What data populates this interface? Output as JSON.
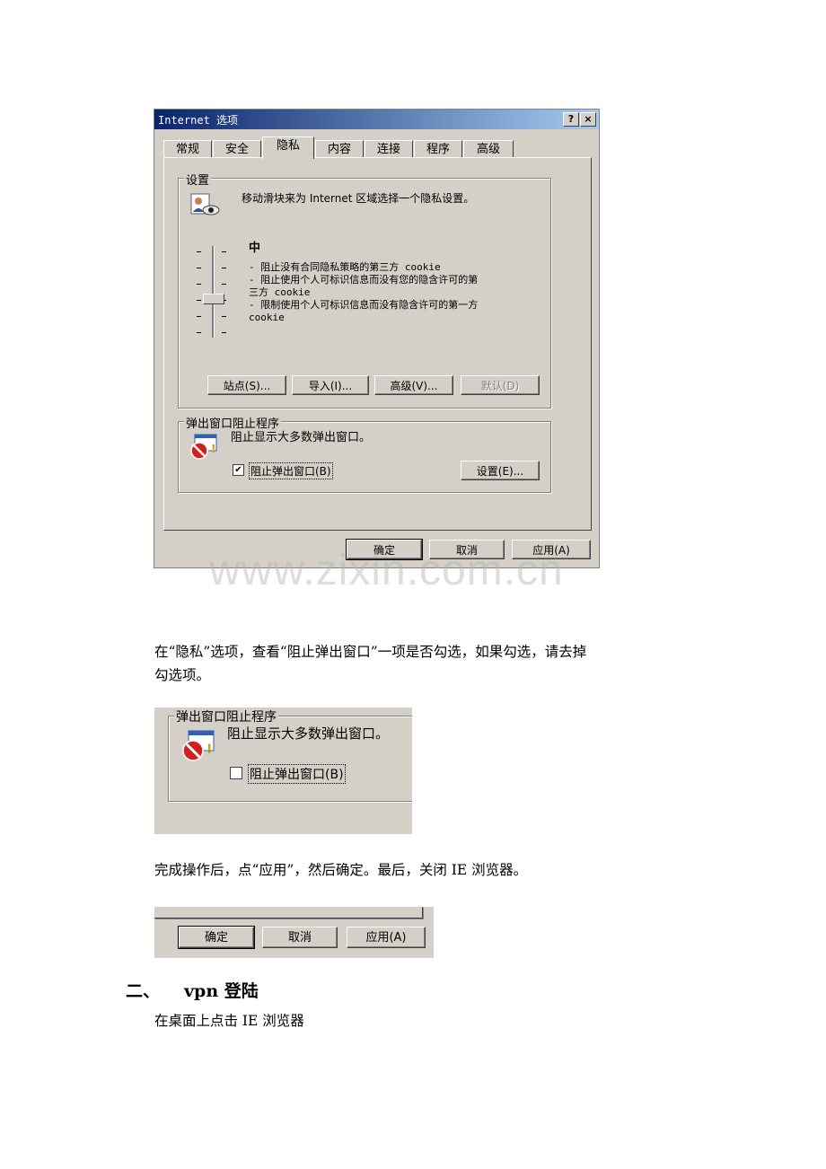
{
  "dialog": {
    "title": "Internet 选项",
    "help_btn": "?",
    "close_btn": "×",
    "tabs": [
      "常规",
      "安全",
      "隐私",
      "内容",
      "连接",
      "程序",
      "高级"
    ],
    "settings_group": {
      "label": "设置",
      "instruction": "移动滑块来为 Internet 区域选择一个隐私设置。",
      "level": "中",
      "level_desc": [
        "- 阻止没有合同隐私策略的第三方 cookie",
        "- 阻止使用个人可标识信息而没有您的隐含许可的第",
        "三方 cookie",
        "- 限制使用个人可标识信息而没有隐含许可的第一方",
        "cookie"
      ],
      "buttons": {
        "sites": "站点(S)...",
        "import": "导入(I)...",
        "advanced": "高级(V)...",
        "default": "默认(D)"
      }
    },
    "popup_group": {
      "label": "弹出窗口阻止程序",
      "desc": "阻止显示大多数弹出窗口。",
      "checkbox_label": "阻止弹出窗口(B)",
      "checked": true,
      "settings_btn": "设置(E)..."
    },
    "footer": {
      "ok": "确定",
      "cancel": "取消",
      "apply": "应用(A)"
    }
  },
  "watermark": "www.zixin.com.cn",
  "para1_line1": "在“隐私”选项，查看“阻止弹出窗口”一项是否勾选，如果勾选，请去掉",
  "para1_line2": "勾选项。",
  "crop2": {
    "label": "弹出窗口阻止程序",
    "desc": "阻止显示大多数弹出窗口。",
    "checkbox_label": "阻止弹出窗口(B)",
    "checked": false
  },
  "para2": "完成操作后，点“应用”，然后确定。最后，关闭 IE 浏览器。",
  "crop3": {
    "ok": "确定",
    "cancel": "取消",
    "apply": "应用(A)"
  },
  "heading": {
    "number": "二、",
    "text": "vpn 登陆"
  },
  "para3": "在桌面上点击 IE 浏览器"
}
